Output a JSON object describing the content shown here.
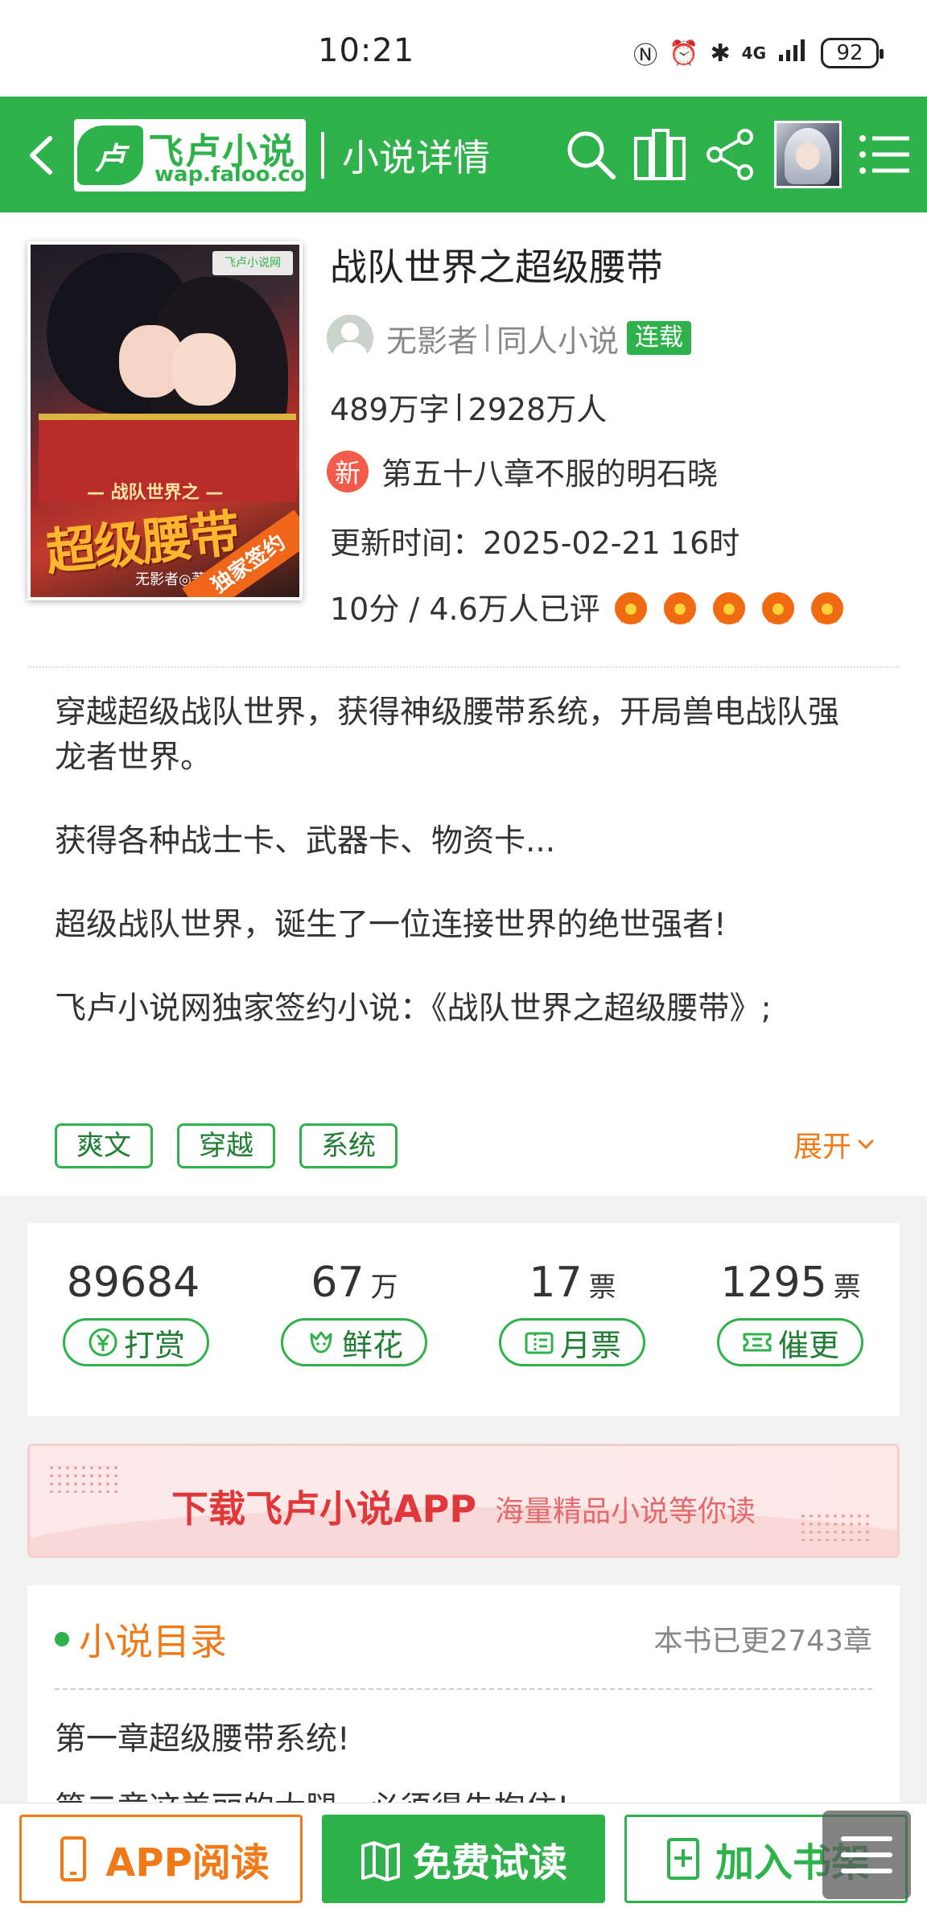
{
  "status_bar": {
    "time": "10:21",
    "network": "4G",
    "battery": "92"
  },
  "top_bar": {
    "logo_name": "飞卢小说",
    "logo_url": "wap.faloo.com",
    "logo_mark": "卢",
    "title": "小说详情",
    "icons": [
      "back-icon",
      "search-icon",
      "bookshelf-icon",
      "share-icon",
      "user-avatar",
      "menu-icon"
    ],
    "accent_color": "#2fb24b"
  },
  "book": {
    "title": "战队世界之超级腰带",
    "author": "无影者",
    "category": "同人小说",
    "status": "连载",
    "word_count": "489万字",
    "readers": "2928万人",
    "new_label": "新",
    "latest_chapter": "第五十八章不服的明石晓",
    "update_time": "更新时间：2025-02-21 16时",
    "rating_text": "10分 / 4.6万人已评",
    "stars": 5,
    "cover": {
      "title_top": "— 战队世界之 —",
      "title_big": "超级腰带",
      "author_mark": "无影者◎著",
      "exclusive": "独家签约",
      "site_badge": "飞卢小说网"
    }
  },
  "intro": {
    "paragraphs": [
      "穿越超级战队世界，获得神级腰带系统，开局兽电战队强龙者世界。",
      "获得各种战士卡、武器卡、物资卡...",
      "超级战队世界，诞生了一位连接世界的绝世强者!",
      "飞卢小说网独家签约小说：《战队世界之超级腰带》;"
    ],
    "tags": [
      "爽文",
      "穿越",
      "系统"
    ],
    "expand_label": "展开"
  },
  "votes": [
    {
      "value": "89684",
      "unit": "",
      "label": "打赏",
      "icon": "yen-icon"
    },
    {
      "value": "67",
      "unit": "万",
      "label": "鲜花",
      "icon": "flower-icon"
    },
    {
      "value": "17",
      "unit": "票",
      "label": "月票",
      "icon": "calendar-ticket-icon"
    },
    {
      "value": "1295",
      "unit": "票",
      "label": "催更",
      "icon": "urge-ticket-icon"
    }
  ],
  "banner": {
    "main": "下载飞卢小说APP",
    "sub": "海量精品小说等你读"
  },
  "toc": {
    "title": "小说目录",
    "count": "本书已更2743章",
    "items": [
      "第一章超级腰带系统!",
      "第二章这美丽的大腿，必须得先抱住!"
    ]
  },
  "bottom_bar": {
    "app_read": "APP阅读",
    "free_read": "免费试读",
    "add_shelf": "加入书架"
  }
}
